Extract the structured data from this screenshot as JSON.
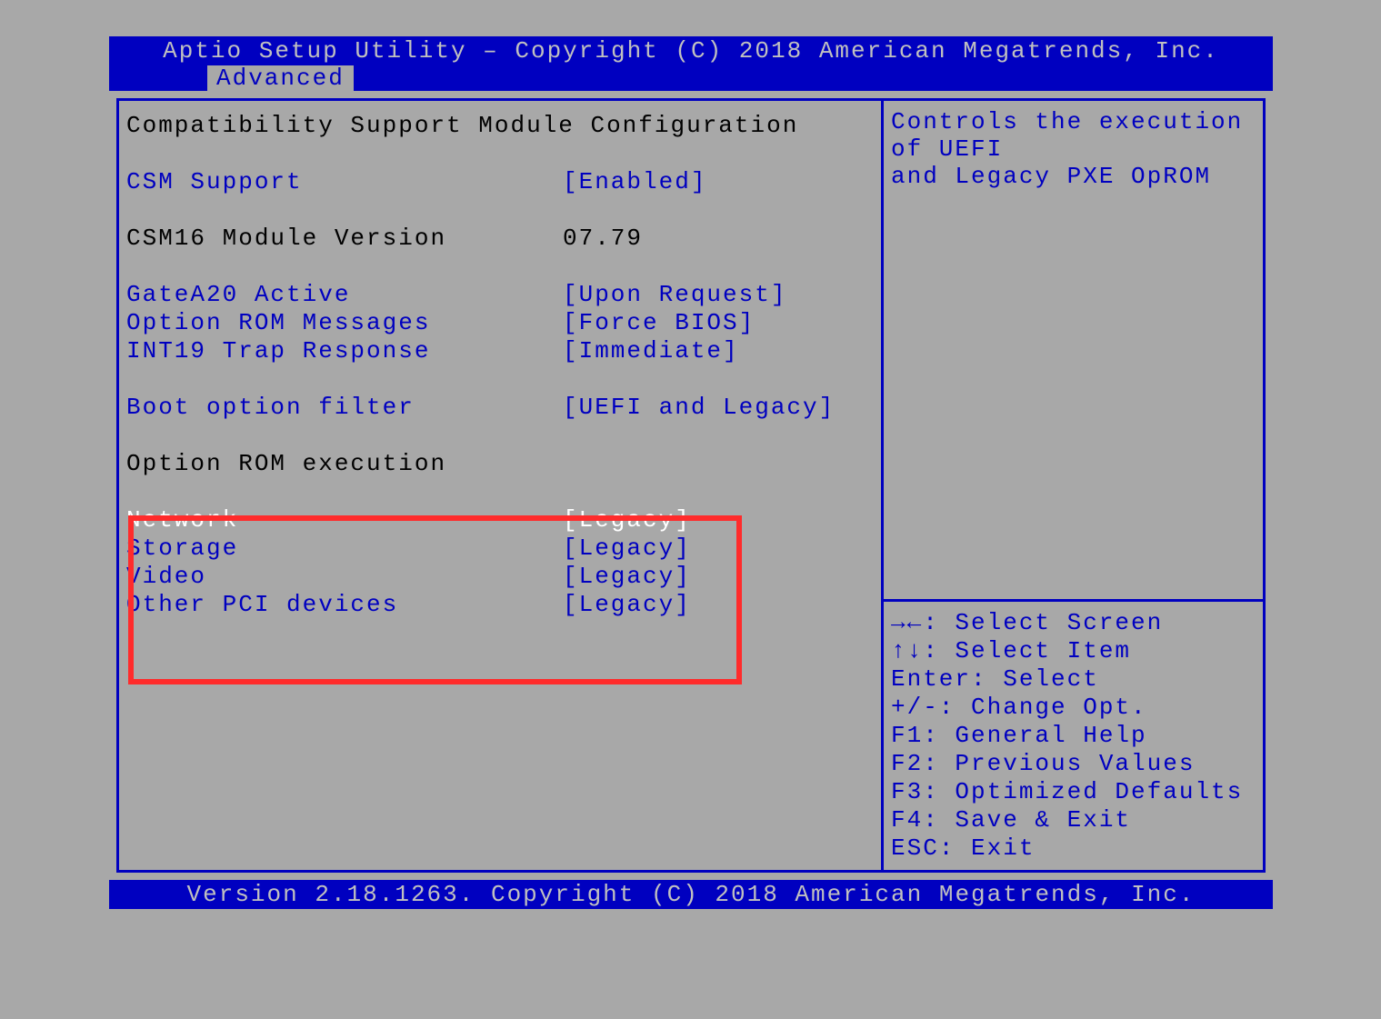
{
  "header": {
    "title": "Aptio Setup Utility – Copyright (C) 2018 American Megatrends, Inc.",
    "tab": "Advanced"
  },
  "main": {
    "section_title": "Compatibility Support Module Configuration",
    "csm_support": {
      "label": "CSM Support",
      "value": "[Enabled]"
    },
    "csm16_version": {
      "label": "CSM16 Module Version",
      "value": "07.79"
    },
    "gatea20": {
      "label": "GateA20 Active",
      "value": "[Upon Request]"
    },
    "oprom_msgs": {
      "label": "Option ROM Messages",
      "value": "[Force BIOS]"
    },
    "int19": {
      "label": "INT19 Trap Response",
      "value": "[Immediate]"
    },
    "boot_filter": {
      "label": "Boot option filter",
      "value": "[UEFI and Legacy]"
    },
    "oprom_exec_header": "Option ROM execution",
    "network": {
      "label": "Network",
      "value": "[Legacy]"
    },
    "storage": {
      "label": "Storage",
      "value": "[Legacy]"
    },
    "video": {
      "label": "Video",
      "value": "[Legacy]"
    },
    "other_pci": {
      "label": "Other PCI devices",
      "value": "[Legacy]"
    }
  },
  "help": {
    "text_line1": "Controls the execution of UEFI",
    "text_line2": "and Legacy PXE OpROM",
    "keys": {
      "select_screen": "→←: Select Screen",
      "select_item": "↑↓: Select Item",
      "enter": "Enter: Select",
      "change": "+/-: Change Opt.",
      "f1": "F1: General Help",
      "f2": "F2: Previous Values",
      "f3": "F3: Optimized Defaults",
      "f4": "F4: Save & Exit",
      "esc": "ESC: Exit"
    }
  },
  "footer": "Version 2.18.1263. Copyright (C) 2018 American Megatrends, Inc."
}
